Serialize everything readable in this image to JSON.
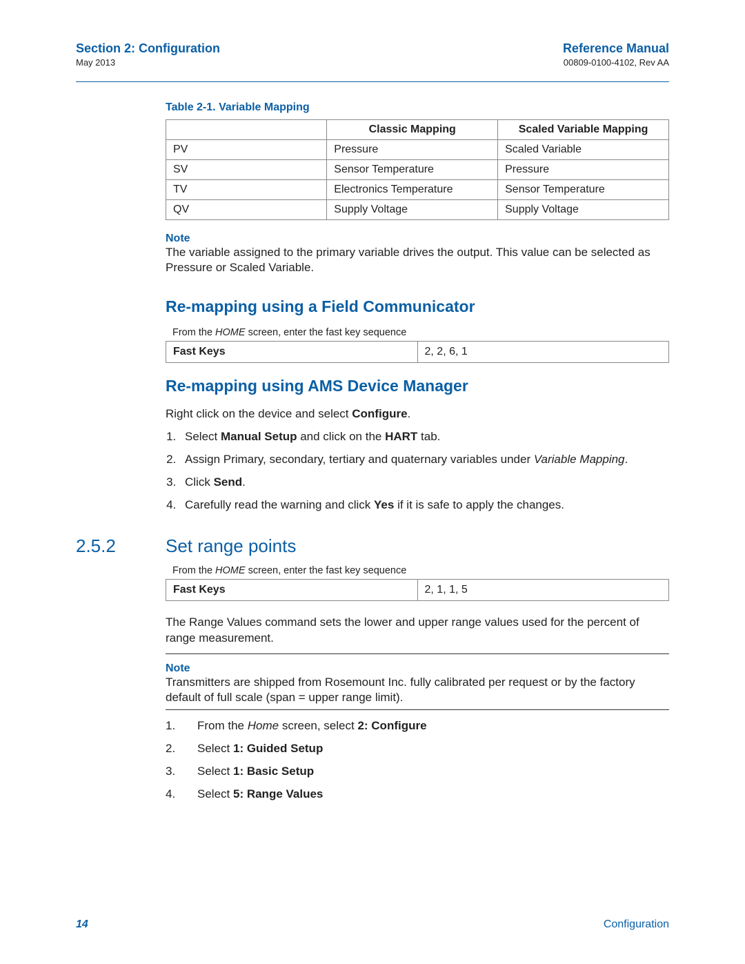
{
  "header": {
    "left_title": "Section 2: Configuration",
    "left_sub": "May 2013",
    "right_title": "Reference Manual",
    "right_sub": "00809-0100-4102, Rev AA"
  },
  "table_caption": "Table 2-1.  Variable Mapping",
  "var_table": {
    "head": {
      "c0": "",
      "c1": "Classic Mapping",
      "c2": "Scaled Variable Mapping"
    },
    "rows": [
      {
        "c0": "PV",
        "c1": "Pressure",
        "c2": "Scaled Variable"
      },
      {
        "c0": "SV",
        "c1": "Sensor Temperature",
        "c2": "Pressure"
      },
      {
        "c0": "TV",
        "c1": "Electronics Temperature",
        "c2": "Sensor Temperature"
      },
      {
        "c0": "QV",
        "c1": "Supply Voltage",
        "c2": "Supply Voltage"
      }
    ]
  },
  "note1": {
    "label": "Note",
    "text": "The variable assigned to the primary variable drives the output. This value can be selected as Pressure or Scaled Variable."
  },
  "sub1_title": "Re-mapping using a Field Communicator",
  "fk_intro_prefix": "From the ",
  "fk_intro_home": "HOME",
  "fk_intro_suffix": " screen, enter the fast key sequence",
  "fk1": {
    "label": "Fast Keys",
    "seq": "2, 2, 6, 1"
  },
  "sub2_title": "Re-mapping using AMS Device Manager",
  "ams_intro_pre": "Right click on the device and select ",
  "ams_intro_bold": "Configure",
  "ams_intro_post": ".",
  "ams_steps": {
    "s1_pre": "Select ",
    "s1_b1": "Manual Setup",
    "s1_mid": " and click on the ",
    "s1_b2": "HART",
    "s1_post": " tab.",
    "s2_pre": "Assign Primary, secondary, tertiary and quaternary variables under ",
    "s2_it": "Variable Mapping",
    "s2_post": ".",
    "s3_pre": "Click ",
    "s3_b": "Send",
    "s3_post": ".",
    "s4_pre": "Carefully read the warning and click ",
    "s4_b": "Yes",
    "s4_post": " if it is safe to apply the changes."
  },
  "sec252": {
    "num": "2.5.2",
    "title": "Set range points"
  },
  "fk2": {
    "label": "Fast Keys",
    "seq": "2, 1, 1, 5"
  },
  "range_text": "The Range Values command sets the lower and upper range values used for the percent of range measurement.",
  "note2": {
    "label": "Note",
    "text": "Transmitters are shipped from Rosemount Inc. fully calibrated per request or by the factory default of full scale (span = upper range limit)."
  },
  "range_steps": {
    "s1_pre": "From the ",
    "s1_it": "Home",
    "s1_mid": " screen, select ",
    "s1_b": "2: Configure",
    "s2_pre": "Select ",
    "s2_b": "1: Guided Setup",
    "s3_pre": "Select ",
    "s3_b": "1: Basic Setup",
    "s4_pre": "Select ",
    "s4_b": "5: Range Values"
  },
  "footer": {
    "page": "14",
    "section": "Configuration"
  }
}
